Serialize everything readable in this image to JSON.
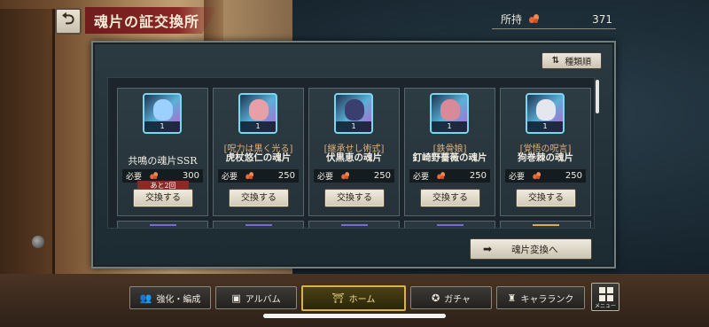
{
  "header": {
    "back_icon": "back-arrow-icon",
    "title": "魂片の証交換所",
    "owned_label": "所持",
    "owned_value": "371"
  },
  "sort": {
    "label": "種類順",
    "icon": "sort-icon"
  },
  "cards": [
    {
      "subname": "",
      "name": "共鳴の魂片SSR",
      "count": "1",
      "req_label": "必要",
      "req_value": "300",
      "remaining": "あと2回",
      "button": "交換する",
      "accent": "#9bd0ff"
    },
    {
      "subname": "[呪力は黒く光る]",
      "name": "虎杖悠仁の魂片",
      "count": "1",
      "req_label": "必要",
      "req_value": "250",
      "remaining": "",
      "button": "交換する",
      "accent": "#e8a0a8"
    },
    {
      "subname": "[継承せし術式]",
      "name": "伏黒恵の魂片",
      "count": "1",
      "req_label": "必要",
      "req_value": "250",
      "remaining": "",
      "button": "交換する",
      "accent": "#3a3f70"
    },
    {
      "subname": "[鉄骨娘]",
      "name": "釘崎野薔薇の魂片",
      "count": "1",
      "req_label": "必要",
      "req_value": "250",
      "remaining": "",
      "button": "交換する",
      "accent": "#d98a9a"
    },
    {
      "subname": "[覚悟の呪言]",
      "name": "狗巻棘の魂片",
      "count": "1",
      "req_label": "必要",
      "req_value": "250",
      "remaining": "",
      "button": "交換する",
      "accent": "#e6e6ee"
    }
  ],
  "convert_button": {
    "label": "魂片変換へ",
    "icon": "arrow-right-icon"
  },
  "nav": [
    {
      "label": "強化・編成",
      "icon": "people-icon",
      "active": false
    },
    {
      "label": "アルバム",
      "icon": "album-icon",
      "active": false
    },
    {
      "label": "ホーム",
      "icon": "home-icon",
      "active": true
    },
    {
      "label": "ガチャ",
      "icon": "gacha-icon",
      "active": false
    },
    {
      "label": "キャラランク",
      "icon": "rank-icon",
      "active": false
    }
  ],
  "menu": {
    "label": "メニュー",
    "icon": "grid-menu-icon"
  },
  "colors": {
    "accent_red": "#8a2626",
    "gold_active": "#d6b44a",
    "currency_orange": "#e8663a"
  }
}
